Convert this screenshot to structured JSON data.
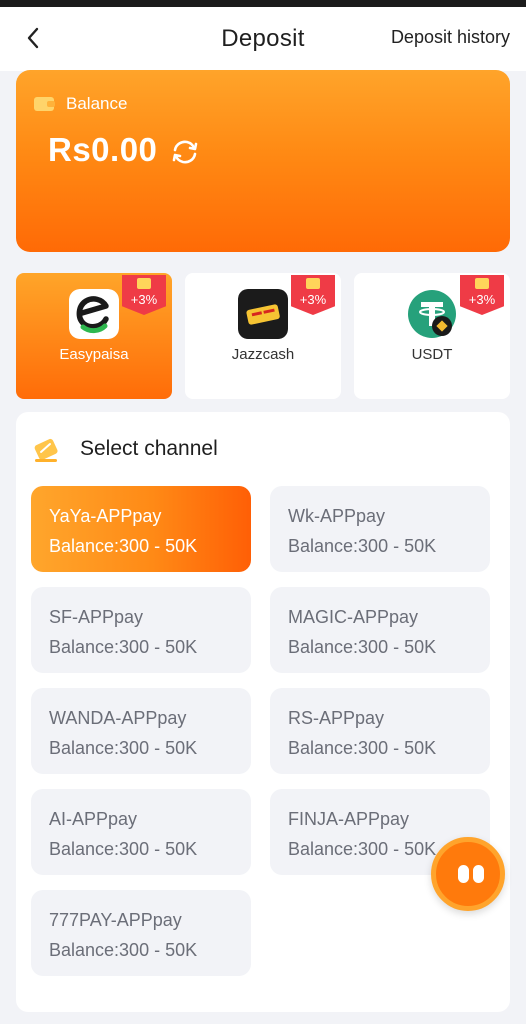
{
  "header": {
    "title": "Deposit",
    "history_label": "Deposit history"
  },
  "balance": {
    "label": "Balance",
    "amount": "Rs0.00"
  },
  "payment_methods": [
    {
      "name": "Easypaisa",
      "bonus": "+3%",
      "selected": true
    },
    {
      "name": "Jazzcash",
      "bonus": "+3%",
      "selected": false
    },
    {
      "name": "USDT",
      "bonus": "+3%",
      "selected": false
    }
  ],
  "channels": {
    "title": "Select channel",
    "items": [
      {
        "name": "YaYa-APPpay",
        "balance": "Balance:300 - 50K",
        "selected": true
      },
      {
        "name": "Wk-APPpay",
        "balance": "Balance:300 - 50K",
        "selected": false
      },
      {
        "name": "SF-APPpay",
        "balance": "Balance:300 - 50K",
        "selected": false
      },
      {
        "name": "MAGIC-APPpay",
        "balance": "Balance:300 - 50K",
        "selected": false
      },
      {
        "name": "WANDA-APPpay",
        "balance": "Balance:300 - 50K",
        "selected": false
      },
      {
        "name": "RS-APPpay",
        "balance": "Balance:300 - 50K",
        "selected": false
      },
      {
        "name": "AI-APPpay",
        "balance": "Balance:300 - 50K",
        "selected": false
      },
      {
        "name": "FINJA-APPpay",
        "balance": "Balance:300 - 50K",
        "selected": false
      },
      {
        "name": "777PAY-APPpay",
        "balance": "Balance:300 - 50K",
        "selected": false
      }
    ]
  },
  "colors": {
    "accent_orange": "#ff7a0c",
    "badge_red": "#ef3b46",
    "background": "#f2f3f7"
  },
  "icons": {
    "back": "chevron-left-icon",
    "wallet": "wallet-icon",
    "refresh": "refresh-icon",
    "channel": "ticket-icon",
    "bonus": "gift-icon",
    "float": "assistant-icon"
  }
}
